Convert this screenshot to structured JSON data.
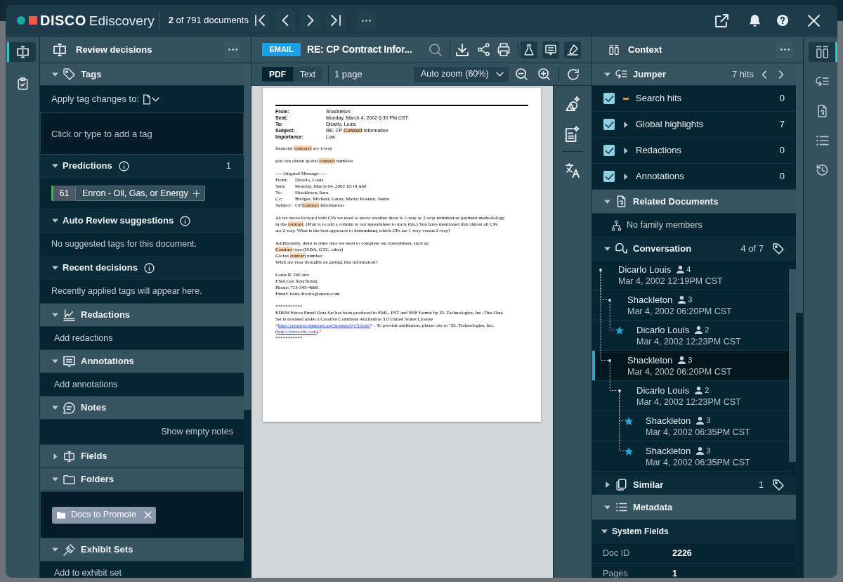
{
  "top_bar": {
    "brand": "DISCO",
    "product": "Ediscovery",
    "doc_position": "**2** of 791 documents"
  },
  "left_rail": [
    {
      "selected": true
    },
    {
      "selected": false
    }
  ],
  "review_panel": {
    "title": "Review decisions",
    "sections": [
      {
        "kind": "tags",
        "title": "Tags",
        "expanded": true,
        "apply_label": "Apply tag changes to:",
        "tag_input": {
          "placeholder": "Click or type to add a tag"
        },
        "subsections": [
          {
            "kind": "predictions",
            "title": "Predictions",
            "expanded": true,
            "count": "1",
            "predictions": [
              {
                "score": "61",
                "label": "Enron - Oil, Gas, or Energy"
              }
            ]
          },
          {
            "kind": "message",
            "title": "Auto Review suggestions",
            "expanded": true,
            "message": "No suggested tags for this document."
          },
          {
            "kind": "message",
            "title": "Recent decisions",
            "expanded": true,
            "message": "Recently applied tags will appear here."
          }
        ]
      },
      {
        "kind": "action",
        "title": "Redactions",
        "expanded": true,
        "action": "Add redactions"
      },
      {
        "kind": "action",
        "title": "Annotations",
        "expanded": true,
        "action": "Add annotations"
      },
      {
        "kind": "notes",
        "title": "Notes",
        "expanded": true,
        "action": "Show empty notes"
      },
      {
        "kind": "fields",
        "title": "Fields",
        "expanded": false
      },
      {
        "kind": "folders",
        "title": "Folders",
        "expanded": true,
        "folders": [
          {
            "label": "Docs to Promote"
          }
        ]
      },
      {
        "kind": "action",
        "title": "Exhibit Sets",
        "expanded": true,
        "action": "Add to exhibit set"
      }
    ]
  },
  "viewer": {
    "doc_type": "EMAIL",
    "title": "RE: CP Contract Infor...",
    "tools": [
      {
        "on": true
      },
      {
        "on": true
      },
      {
        "on": true
      }
    ],
    "view_modes": [
      {
        "label": "PDF",
        "selected": true
      },
      {
        "label": "Text",
        "selected": false
      }
    ],
    "page_count": "1 page",
    "zoom": {
      "value": "Auto zoom (60%)"
    },
    "page": {
      "header_fields": [
        {
          "label": "From:",
          "value": [
            {
              "kind": "plain",
              "text": "Shackleton"
            }
          ]
        },
        {
          "label": "Sent:",
          "value": [
            {
              "kind": "plain",
              "text": "Monday, March 4, 2002 6:30 PM CST"
            }
          ]
        },
        {
          "label": "To:",
          "value": [
            {
              "kind": "plain",
              "text": "Dicarlo, Louis"
            }
          ]
        },
        {
          "label": "Subject:",
          "value": [
            {
              "kind": "plain",
              "text": "RE: CP "
            },
            {
              "kind": "hit",
              "text": "Contract"
            },
            {
              "kind": "plain",
              "text": " Information"
            }
          ]
        },
        {
          "label": "Importance:",
          "value": [
            {
              "kind": "plain",
              "text": "Low"
            }
          ]
        }
      ],
      "blocks": [
        [
          [
            {
              "kind": "plain",
              "text": "financial "
            },
            {
              "kind": "hit",
              "text": "contracts"
            },
            {
              "kind": "plain",
              "text": " are 1-way"
            }
          ]
        ],
        [
          [
            {
              "kind": "plain",
              "text": "you can obtain global "
            },
            {
              "kind": "hit",
              "text": "contract"
            },
            {
              "kind": "plain",
              "text": " numbers"
            }
          ]
        ],
        [
          [
            {
              "kind": "plain",
              "text": "-----Original Message-----"
            }
          ],
          [
            {
              "kind": "label",
              "text": "From:"
            },
            {
              "kind": "plain",
              "text": "Dicarlo, Louis"
            }
          ],
          [
            {
              "kind": "label",
              "text": "Sent:"
            },
            {
              "kind": "plain",
              "text": "Monday, March 04, 2002 10:19 AM"
            }
          ],
          [
            {
              "kind": "label",
              "text": "To:"
            },
            {
              "kind": "plain",
              "text": "Shackleton, Sara"
            }
          ],
          [
            {
              "kind": "label",
              "text": "Cc:"
            },
            {
              "kind": "plain",
              "text": "Bridges, Michael; Garza, Maria; Rostant, Justin"
            }
          ],
          [
            {
              "kind": "label",
              "text": "Subject:"
            },
            {
              "kind": "plain",
              "text": "CP "
            },
            {
              "kind": "hit",
              "text": "Contract"
            },
            {
              "kind": "plain",
              "text": " Information"
            }
          ]
        ],
        [
          [
            {
              "kind": "plain",
              "text": "As we move forward with CPs we need to know weather there is 1-way or 2-way termination payment methodology"
            }
          ],
          [
            {
              "kind": "plain",
              "text": "in the "
            },
            {
              "kind": "hit",
              "text": "contract"
            },
            {
              "kind": "plain",
              "text": ". (Plan is to add a column to our spreadsheet to track this.) You have mentioned that almost all CPs"
            }
          ],
          [
            {
              "kind": "plain",
              "text": "are 2-way. What is the best approach to determining which CPs are 1-way versus 2-way?"
            }
          ]
        ],
        [
          [
            {
              "kind": "plain",
              "text": "Additionally, there is other data we need to complete our spreadsheet, such as:"
            }
          ],
          [
            {
              "kind": "hit",
              "text": "Contract"
            },
            {
              "kind": "plain",
              "text": " type (ISDA, GTC, other)"
            }
          ],
          [
            {
              "kind": "plain",
              "text": "Global "
            },
            {
              "kind": "hit",
              "text": "contract"
            },
            {
              "kind": "plain",
              "text": " number"
            }
          ],
          [
            {
              "kind": "plain",
              "text": "What are your thoughts on getting this information?"
            }
          ]
        ],
        [
          [
            {
              "kind": "plain",
              "text": "Louis R. DiCarlo"
            }
          ],
          [
            {
              "kind": "plain",
              "text": "ENA Gas Structuring"
            }
          ],
          [
            {
              "kind": "plain",
              "text": "Phone: 713-345-4666"
            }
          ],
          [
            {
              "kind": "plain",
              "text": "Email: louis.dicarlo@enron.com"
            }
          ]
        ],
        [
          [
            {
              "kind": "plain",
              "text": "***********"
            }
          ],
          [
            {
              "kind": "plain",
              "text": "EDRM Enron Email Data Set has been produced in EML, PST and NSF format by ZL Technologies, Inc. This Data"
            }
          ],
          [
            {
              "kind": "plain",
              "text": "Set is licensed under a Creative Commons Attribution 3.0 United States License"
            }
          ],
          [
            {
              "kind": "plain",
              "text": "<"
            },
            {
              "kind": "link",
              "text": "http://creativecommons.org/licenses/by/3.0/us/"
            },
            {
              "kind": "plain",
              "text": "> . To provide attribution, please cite to \"ZL Technologies, Inc."
            }
          ],
          [
            {
              "kind": "plain",
              "text": "("
            },
            {
              "kind": "link",
              "text": "http://www.zlti.com"
            },
            {
              "kind": "plain",
              "text": ").\""
            }
          ],
          [
            {
              "kind": "plain",
              "text": "***********"
            }
          ]
        ]
      ]
    }
  },
  "context_panel": {
    "title": "Context",
    "jumper": {
      "title": "Jumper",
      "expanded": true,
      "hits": "7 hits",
      "filters": [
        {
          "kind": "swatch",
          "label": "Search hits",
          "checked": true,
          "count": "0"
        },
        {
          "kind": "group",
          "label": "Global highlights",
          "checked": true,
          "expanded": false,
          "count": "7"
        },
        {
          "kind": "group",
          "label": "Redactions",
          "checked": true,
          "expanded": false,
          "count": "0"
        },
        {
          "kind": "group",
          "label": "Annotations",
          "checked": true,
          "expanded": false,
          "count": "0"
        }
      ]
    },
    "related_documents": {
      "title": "Related Documents",
      "expanded": true,
      "family": "No family members"
    },
    "conversation": {
      "title": "Conversation",
      "expanded": true,
      "position": "4 of 7",
      "messages": [
        {
          "sender": "Dicarlo Louis",
          "participants": "4",
          "date": "Mar 4, 2002 12:19PM CST",
          "starred": false,
          "selected": false,
          "children": [
            {
              "sender": "Shackleton",
              "participants": "3",
              "date": "Mar 4, 2002 06:20PM CST",
              "starred": false,
              "selected": false,
              "children": [
                {
                  "sender": "Dicarlo Louis",
                  "participants": "2",
                  "date": "Mar 4, 2002 12:23PM CST",
                  "starred": true,
                  "selected": false
                }
              ]
            },
            {
              "sender": "Shackleton",
              "participants": "3",
              "date": "Mar 4, 2002 06:20PM CST",
              "starred": false,
              "selected": true,
              "children": [
                {
                  "sender": "Dicarlo Louis",
                  "participants": "2",
                  "date": "Mar 4, 2002 12:23PM CST",
                  "starred": false,
                  "selected": false,
                  "children": [
                    {
                      "sender": "Shackleton",
                      "participants": "3",
                      "date": "Mar 4, 2002 06:35PM CST",
                      "starred": true,
                      "selected": false
                    },
                    {
                      "sender": "Shackleton",
                      "participants": "3",
                      "date": "Mar 4, 2002 06:35PM CST",
                      "starred": true,
                      "selected": false
                    }
                  ]
                }
              ]
            }
          ]
        }
      ]
    },
    "similar": {
      "title": "Similar",
      "expanded": false,
      "count": "1"
    },
    "metadata": {
      "title": "Metadata",
      "expanded": true,
      "groups": [
        {
          "title": "System Fields",
          "expanded": true,
          "fields": [
            {
              "name": "Doc ID",
              "value": "2226"
            },
            {
              "name": "Pages",
              "value": "1"
            }
          ]
        }
      ]
    }
  },
  "right_rail": [
    {
      "selected": true
    },
    {
      "selected": false
    },
    {
      "selected": false
    },
    {
      "selected": false
    },
    {
      "selected": false
    }
  ]
}
